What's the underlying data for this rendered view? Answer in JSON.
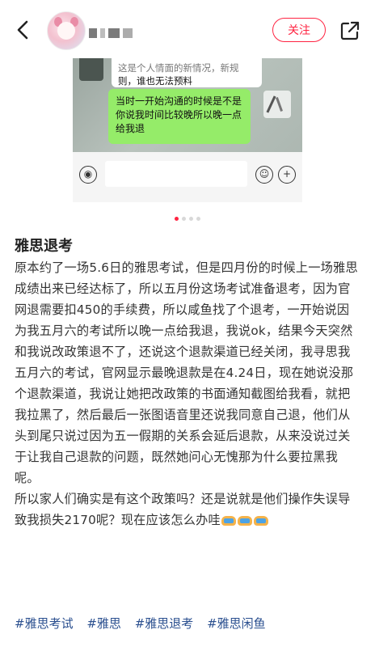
{
  "header": {
    "follow_label": "关注"
  },
  "chat_image": {
    "white_bubble_line1": "这是个人情面的新情况，新规",
    "white_bubble_line2": "则，谁也无法预料",
    "green_bubble": "当时一开始沟通的时候是不是你说我时间比较晚所以晚一点给我退",
    "carousel_count": 4,
    "carousel_active": 1
  },
  "post": {
    "title": "雅思退考",
    "body_line1": "原本约了一场5.6日的雅思考试，但是四月份的时候上一场雅思成绩出来已经达标了，所以五月份这场考试准备退考，因为官网退需要扣450的手续费，所以咸鱼找了个退考，一开始说因为我五月六的考试所以晚一点给我退，我说ok，结果今天突然和我说改政策退不了，还说这个退款渠道已经关闭，我寻思我五月六的考试，官网显示最晚退款是在4.24日，现在她说没那个退款渠道，我说让她把改政策的书面通知截图给我看，就把我拉黑了，然后最后一张图语音里还说我同意自己退，他们从头到尾只说过因为五一假期的关系会延后退款，从来没说过关于让我自己退款的问题，既然她问心无愧那为什么要拉黑我呢。",
    "body_line2": "所以家人们确实是有这个政策吗？还是说就是他们操作失误导致我损失2170呢？现在应该怎么办哇",
    "tags": [
      "#雅思考试",
      "#雅思",
      "#雅思退考",
      "#雅思闲鱼"
    ]
  }
}
